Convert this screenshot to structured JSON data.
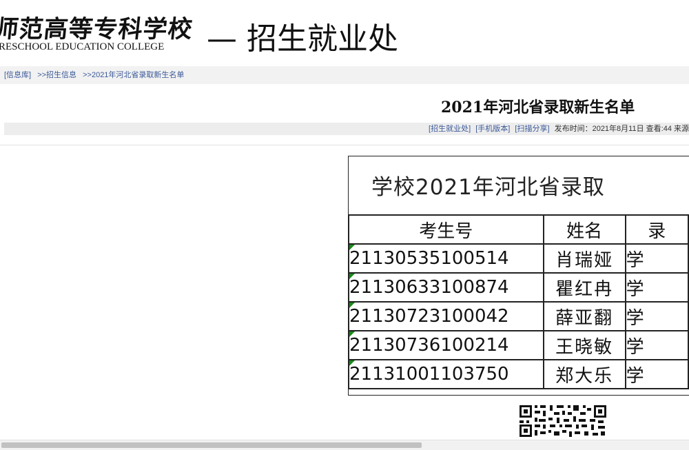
{
  "header": {
    "school_name": "师范高等专科学校",
    "school_name_en": "RESCHOOL EDUCATION COLLEGE",
    "dept": "— 招生就业处"
  },
  "breadcrumb": [
    "[信息库]",
    ">>招生信息",
    ">>2021年河北省录取新生名单"
  ],
  "article": {
    "title": "2021年河北省录取新生名单",
    "meta_links": [
      "[招生就业处]",
      "[手机版本]",
      "[扫描分享]"
    ],
    "meta_text": "发布时间：2021年8月11日  查看:44  来源"
  },
  "sheet": {
    "title": "学校2021年河北省录取",
    "columns": [
      "考生号",
      "姓名",
      "录"
    ],
    "rows": [
      {
        "id": "21130535100514",
        "name": "肖瑞娅",
        "major": "学"
      },
      {
        "id": "21130633100874",
        "name": "瞿红冉",
        "major": "学"
      },
      {
        "id": "21130723100042",
        "name": "薛亚翻",
        "major": "学"
      },
      {
        "id": "21130736100214",
        "name": "王晓敏",
        "major": "学"
      },
      {
        "id": "21131001103750",
        "name": "郑大乐",
        "major": "学"
      }
    ]
  }
}
